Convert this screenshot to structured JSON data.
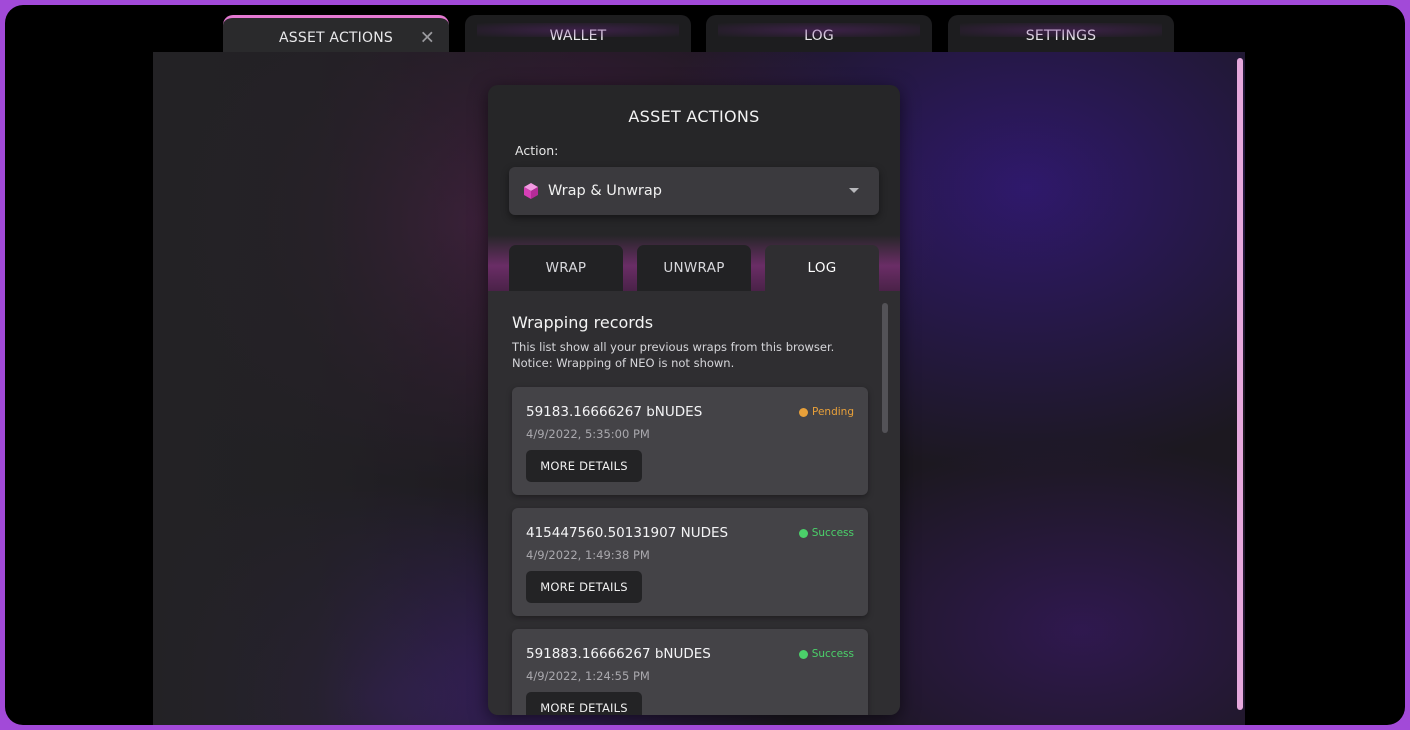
{
  "top_tabs": [
    {
      "label": "ASSET ACTIONS",
      "close_glyph": "✕"
    },
    {
      "label": "WALLET"
    },
    {
      "label": "LOG"
    },
    {
      "label": "SETTINGS"
    }
  ],
  "panel": {
    "title": "ASSET ACTIONS",
    "action_label": "Action:",
    "selected_action": "Wrap & Unwrap",
    "action_icon": "box-icon",
    "subtabs": [
      {
        "label": "WRAP"
      },
      {
        "label": "UNWRAP"
      },
      {
        "label": "LOG"
      }
    ],
    "records_title": "Wrapping records",
    "records_desc_1": "This list show all your previous wraps from this browser.",
    "records_desc_2": "Notice: Wrapping of NEO is not shown.",
    "records": [
      {
        "amount": "59183.16666267 bNUDES",
        "date": "4/9/2022, 5:35:00 PM",
        "status": "Pending",
        "button": "MORE DETAILS"
      },
      {
        "amount": "415447560.50131907 NUDES",
        "date": "4/9/2022, 1:49:38 PM",
        "status": "Success",
        "button": "MORE DETAILS"
      },
      {
        "amount": "591883.16666267 bNUDES",
        "date": "4/9/2022, 1:24:55 PM",
        "status": "Success",
        "button": "MORE DETAILS"
      }
    ]
  },
  "colors": {
    "accent": "#e479d2",
    "pending": "#e8a03a",
    "success": "#4bd16a",
    "frame_border": "#a24ad8"
  }
}
